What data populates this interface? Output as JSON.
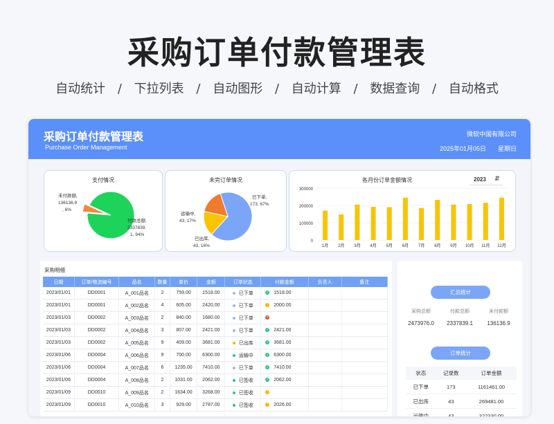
{
  "hero": {
    "title": "采购订单付款管理表",
    "features": [
      "自动统计",
      "下拉列表",
      "自动图形",
      "自动计算",
      "数据查询",
      "自动格式"
    ],
    "separator": "/"
  },
  "header": {
    "title": "采购订单付款管理表",
    "subtitle": "Purchase Order Management",
    "company": "微软中国有限公司",
    "date": "2025年01月05日",
    "weekday": "星期日"
  },
  "pay_chart": {
    "title": "支付情况",
    "label_unpaid_1": "未付款额,",
    "label_unpaid_2": "136136.9",
    "label_unpaid_3": ", 6%",
    "label_paid_1": "付款总额,",
    "label_paid_2": "2337839.",
    "label_paid_3": "1, 94%"
  },
  "pending_chart": {
    "title": "未完订单情况",
    "label_ordered_1": "已下单,",
    "label_ordered_2": "173, 67%",
    "label_transit_1": "运输中,",
    "label_transit_2": "43, 17%",
    "label_shipped_1": "已出库,",
    "label_shipped_2": "43, 16%"
  },
  "monthly_chart": {
    "title": "各月份订单金额情况",
    "year": "2023",
    "y_ticks": [
      "300000",
      "200000",
      "100000",
      "0"
    ]
  },
  "chart_data": [
    {
      "type": "pie",
      "title": "支付情况",
      "labels": [
        "未付款额",
        "付款总额"
      ],
      "values": [
        136136.9,
        2337839.1
      ],
      "percents": [
        6,
        94
      ],
      "colors": [
        "#f08a3c",
        "#1ed35a"
      ]
    },
    {
      "type": "pie",
      "title": "未完订单情况",
      "labels": [
        "已下单",
        "运输中",
        "已出库"
      ],
      "values": [
        173,
        43,
        43
      ],
      "percents": [
        67,
        17,
        16
      ],
      "colors": [
        "#7ba5f7",
        "#f9c400",
        "#f07b2c"
      ]
    },
    {
      "type": "bar",
      "title": "各月份订单金额情况",
      "categories": [
        "1月",
        "2月",
        "3月",
        "4月",
        "5月",
        "6月",
        "7月",
        "8月",
        "9月",
        "10月",
        "11月",
        "12月"
      ],
      "values": [
        170000,
        148000,
        205000,
        192000,
        190000,
        245000,
        185000,
        232000,
        205000,
        208000,
        215000,
        245000
      ],
      "ylim": [
        0,
        300000
      ],
      "yticks": [
        0,
        100000,
        200000,
        300000
      ],
      "color": "#f9c400",
      "grid": true
    }
  ],
  "detail": {
    "title": "采购明细",
    "columns": [
      "日期",
      "订单/物流编号",
      "品名",
      "数量",
      "单价",
      "金额",
      "订单状态",
      "付款金额",
      "负责人",
      "备注"
    ],
    "rows": [
      {
        "date": "2023/01/01",
        "order": "DD0001",
        "item": "A_001品名",
        "qty": "2",
        "price": "759.00",
        "amount": "1518.00",
        "status": "已下单",
        "dot": "#9fb7e0",
        "pay_icon": "ok",
        "paid": "1518.00"
      },
      {
        "date": "2023/01/01",
        "order": "DD0001",
        "item": "A_002品名",
        "qty": "4",
        "price": "605.00",
        "amount": "2420.00",
        "status": "已下单",
        "dot": "#9fb7e0",
        "pay_icon": "warn",
        "paid": "2000.00"
      },
      {
        "date": "2023/01/03",
        "order": "DD0002",
        "item": "A_003品名",
        "qty": "2",
        "price": "840.00",
        "amount": "1680.00",
        "status": "已下单",
        "dot": "#9fb7e0",
        "pay_icon": "x",
        "paid": ""
      },
      {
        "date": "2023/01/03",
        "order": "DD0002",
        "item": "A_004品名",
        "qty": "3",
        "price": "807.00",
        "amount": "2421.00",
        "status": "已下单",
        "dot": "#9fb7e0",
        "pay_icon": "ok",
        "paid": "2421.00"
      },
      {
        "date": "2023/01/03",
        "order": "DD0002",
        "item": "A_005品名",
        "qty": "9",
        "price": "409.00",
        "amount": "3681.00",
        "status": "已出库",
        "dot": "#f4b400",
        "pay_icon": "ok",
        "paid": "3681.00"
      },
      {
        "date": "2023/01/06",
        "order": "DD0004",
        "item": "A_006品名",
        "qty": "9",
        "price": "700.00",
        "amount": "6300.00",
        "status": "运输中",
        "dot": "#2ec27e",
        "pay_icon": "ok",
        "paid": "6300.00"
      },
      {
        "date": "2023/01/06",
        "order": "DD0004",
        "item": "A_007品名",
        "qty": "6",
        "price": "1235.00",
        "amount": "7410.00",
        "status": "已下单",
        "dot": "#9fb7e0",
        "pay_icon": "ok",
        "paid": "7410.00"
      },
      {
        "date": "2023/01/06",
        "order": "DD0004",
        "item": "A_008品名",
        "qty": "2",
        "price": "1031.00",
        "amount": "2062.00",
        "status": "已签收",
        "dot": "#2ec27e",
        "pay_icon": "ok",
        "paid": "2062.00"
      },
      {
        "date": "2023/01/09",
        "order": "DD0010",
        "item": "A_009品名",
        "qty": "2",
        "price": "1634.00",
        "amount": "3268.00",
        "status": "已签收",
        "dot": "#2ec27e",
        "pay_icon": "warn",
        "paid": ""
      },
      {
        "date": "2023/01/09",
        "order": "DD0010",
        "item": "A_010品名",
        "qty": "3",
        "price": "929.00",
        "amount": "2787.00",
        "status": "已签收",
        "dot": "#2ec27e",
        "pay_icon": "warn",
        "paid": "2026.00"
      }
    ]
  },
  "summary": {
    "button": "汇总统计",
    "labels": [
      "采购总额",
      "付款总额",
      "未付款额"
    ],
    "values": [
      "2473976.0",
      "2337839.1",
      "136136.9"
    ]
  },
  "order_stats": {
    "button": "订单统计",
    "columns": [
      "状态",
      "记录数",
      "订单金额"
    ],
    "rows": [
      [
        "已下单",
        "173",
        "1161461.00"
      ],
      [
        "已出库",
        "43",
        "269481.00"
      ],
      [
        "运输中",
        "43",
        "322330.00"
      ]
    ]
  }
}
